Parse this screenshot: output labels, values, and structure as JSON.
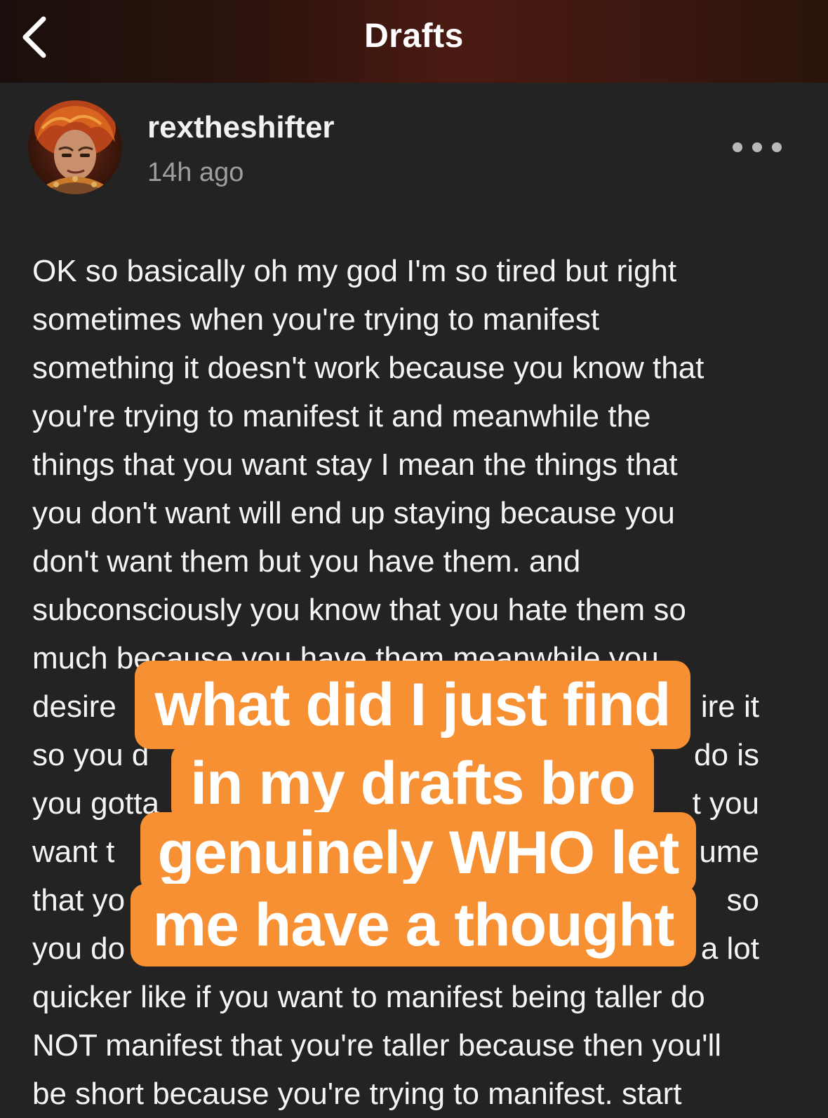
{
  "topbar": {
    "title": "Drafts",
    "background_color": "#2c130d"
  },
  "post": {
    "username": "rextheshifter",
    "timestamp": "14h ago",
    "body_lines": [
      "OK so basically oh my god I'm so tired but right",
      "sometimes when you're trying to manifest",
      "something it doesn't work because you know that",
      "you're trying to manifest it and meanwhile the",
      "things that you want stay I mean the things that",
      "you don't want will end up staying because you",
      "don't want them but you have them. and",
      "subconsciously you know that you hate them so",
      "much because you have them meanwhile you",
      "desire",
      "so you d",
      "you gotta",
      "want t",
      "that yo",
      "you do",
      "quicker like if you want to manifest being taller do",
      "NOT manifest that you're taller because then you'll",
      "be short because you're trying to manifest. start"
    ],
    "body_line_right_fragments": [
      "",
      "",
      "",
      "",
      "",
      "",
      "",
      "",
      "",
      "ire it",
      "do is",
      "t you",
      "ume",
      "so",
      "a lot",
      "",
      "",
      ""
    ]
  },
  "caption_overlay": {
    "lines": [
      "what did I just find",
      "in my drafts bro",
      "genuinely WHO let",
      "me have a thought"
    ],
    "background_color": "#f78f33",
    "text_color": "#ffffff"
  },
  "icons": {
    "back": "chevron-left-icon",
    "more": "more-horizontal-icon",
    "avatar": "user-avatar"
  }
}
